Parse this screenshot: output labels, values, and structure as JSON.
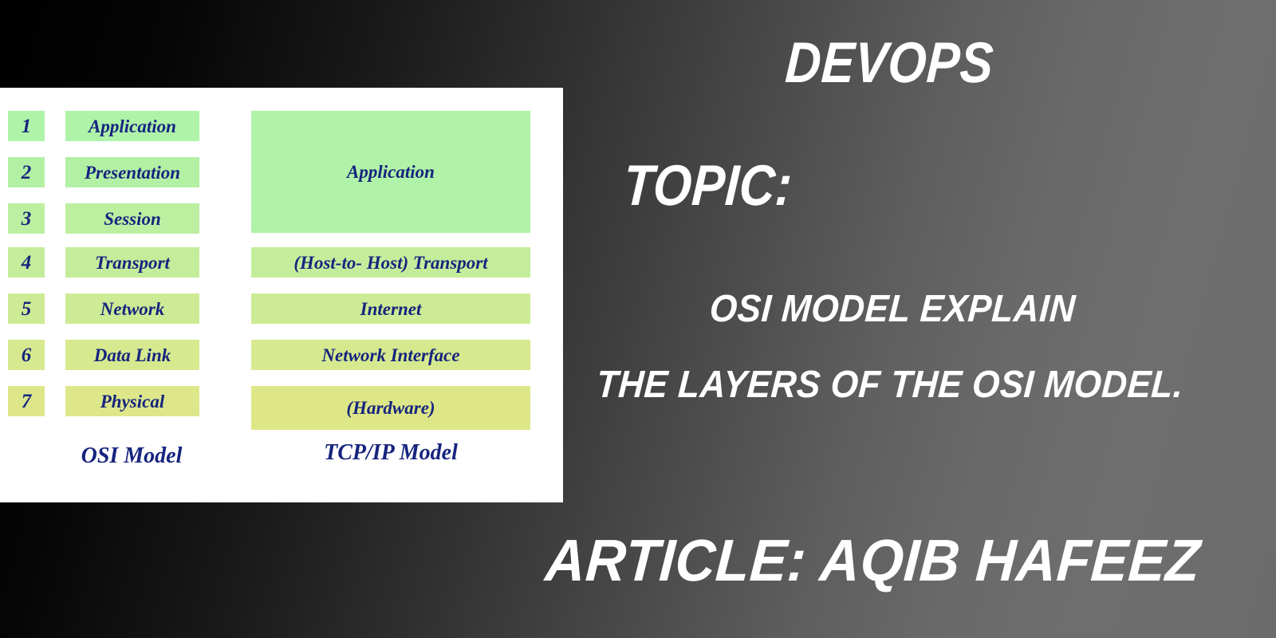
{
  "slide": {
    "background_start": "#000000",
    "background_end": "#6b6b6b",
    "panel_background": "#ffffff",
    "label_text_color": "#16247e",
    "heading_text_color": "#ffffff"
  },
  "headings": {
    "devops": "DEVOPS",
    "topic_label": "TOPIC:",
    "topic_line1": "OSI MODEL EXPLAIN",
    "topic_line2": "THE LAYERS OF THE OSI MODEL.",
    "article_credit": "ARTICLE: AQIB HAFEEZ"
  },
  "diagram": {
    "osi_caption": "OSI Model",
    "tcpip_caption": "TCP/IP Model",
    "osi_layers": [
      {
        "number": "1",
        "name": "Application",
        "color": "#aff3a9"
      },
      {
        "number": "2",
        "name": "Presentation",
        "color": "#b2f0a4"
      },
      {
        "number": "3",
        "name": "Session",
        "color": "#bcefa0"
      },
      {
        "number": "4",
        "name": "Transport",
        "color": "#c4ed9b"
      },
      {
        "number": "5",
        "name": "Network",
        "color": "#cdeb95"
      },
      {
        "number": "6",
        "name": "Data Link",
        "color": "#d6e98f"
      },
      {
        "number": "7",
        "name": "Physical",
        "color": "#dde78a"
      }
    ],
    "tcpip_layers": [
      {
        "name": "Application",
        "color": "#b0f2a7",
        "spans": "1-3"
      },
      {
        "name": "(Host-to- Host) Transport",
        "color": "#c4ed9b",
        "spans": "4"
      },
      {
        "name": "Internet",
        "color": "#cdeb95",
        "spans": "5"
      },
      {
        "name": "Network Interface",
        "color": "#d6e98f",
        "spans": "6"
      },
      {
        "name": "(Hardware)",
        "color": "#dee787",
        "spans": "7"
      }
    ]
  }
}
